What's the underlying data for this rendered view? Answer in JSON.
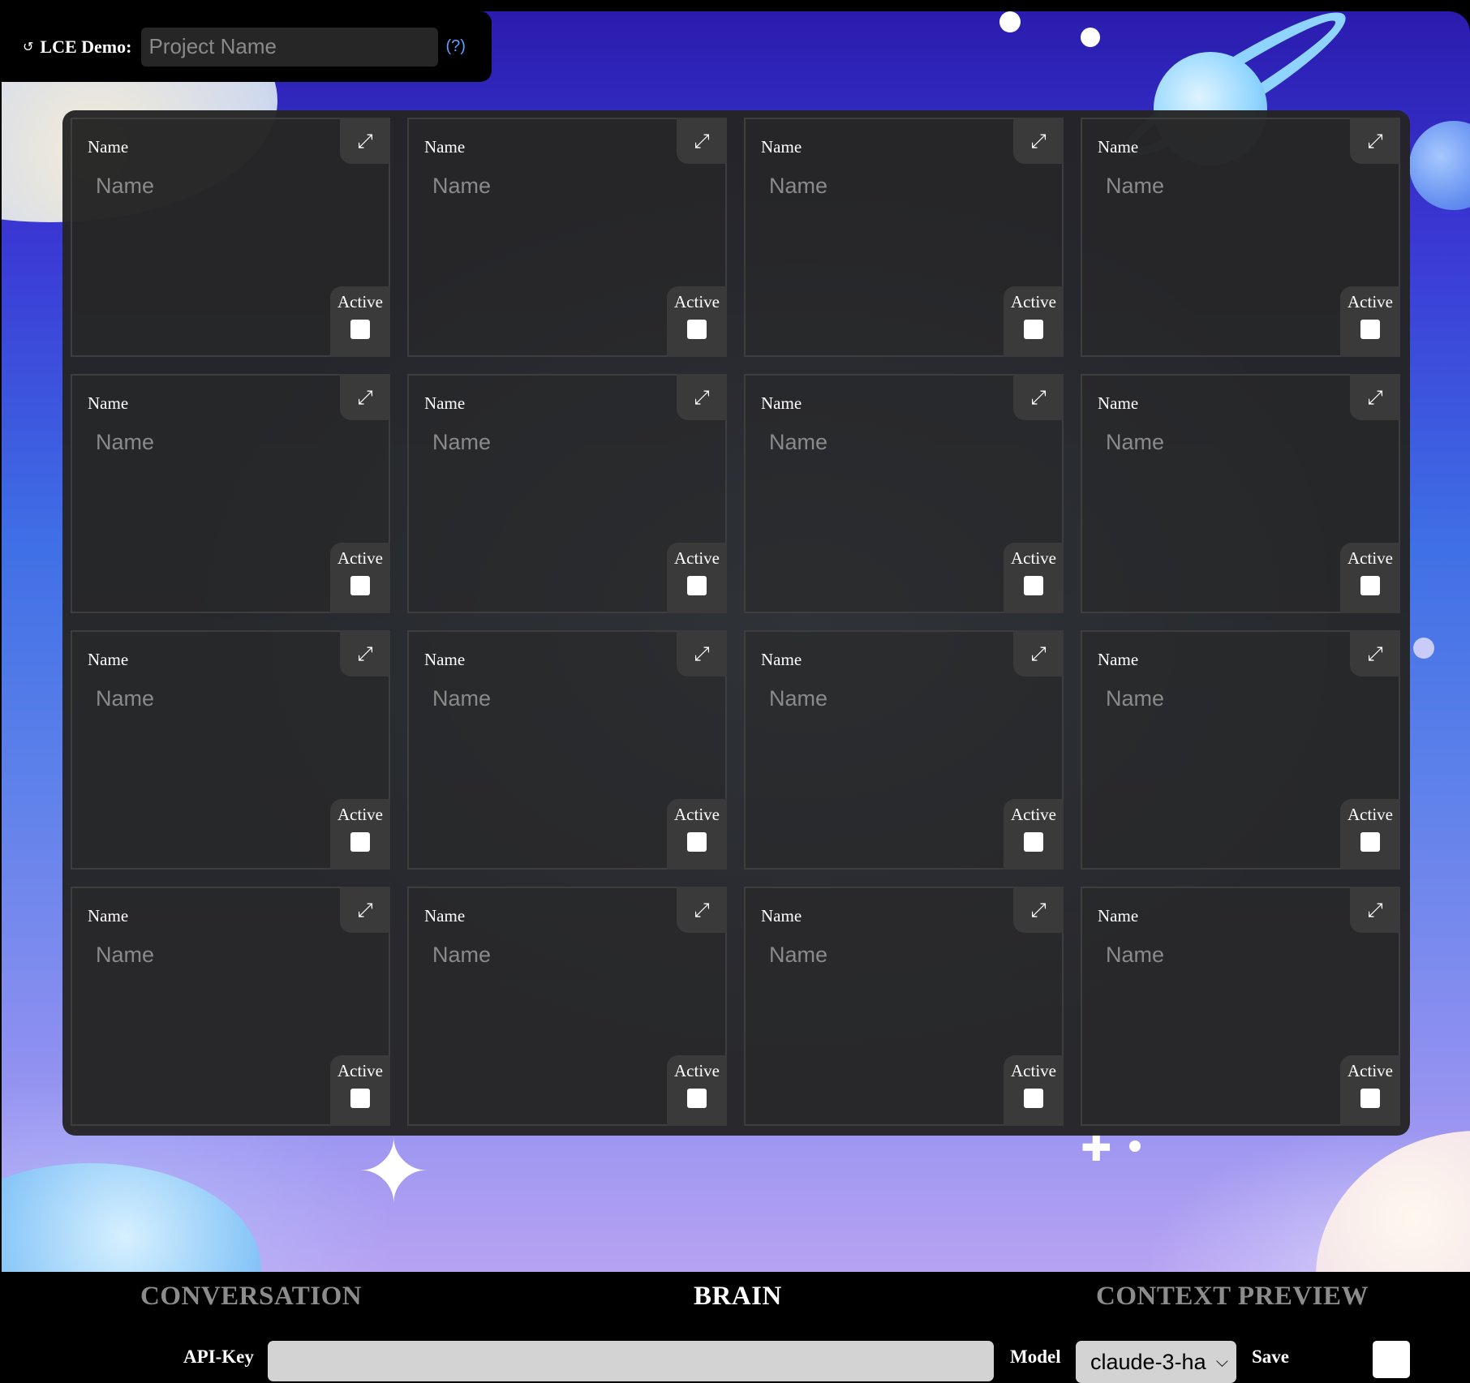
{
  "header": {
    "reload_icon": "↺",
    "title": "LCE Demo:",
    "project_placeholder": "Project Name",
    "help_text": "(?)"
  },
  "cards": [
    {
      "label": "Name",
      "placeholder": "Name",
      "active_label": "Active",
      "active": false
    },
    {
      "label": "Name",
      "placeholder": "Name",
      "active_label": "Active",
      "active": false
    },
    {
      "label": "Name",
      "placeholder": "Name",
      "active_label": "Active",
      "active": false
    },
    {
      "label": "Name",
      "placeholder": "Name",
      "active_label": "Active",
      "active": false
    },
    {
      "label": "Name",
      "placeholder": "Name",
      "active_label": "Active",
      "active": false
    },
    {
      "label": "Name",
      "placeholder": "Name",
      "active_label": "Active",
      "active": false
    },
    {
      "label": "Name",
      "placeholder": "Name",
      "active_label": "Active",
      "active": false
    },
    {
      "label": "Name",
      "placeholder": "Name",
      "active_label": "Active",
      "active": false
    },
    {
      "label": "Name",
      "placeholder": "Name",
      "active_label": "Active",
      "active": false
    },
    {
      "label": "Name",
      "placeholder": "Name",
      "active_label": "Active",
      "active": false
    },
    {
      "label": "Name",
      "placeholder": "Name",
      "active_label": "Active",
      "active": false
    },
    {
      "label": "Name",
      "placeholder": "Name",
      "active_label": "Active",
      "active": false
    },
    {
      "label": "Name",
      "placeholder": "Name",
      "active_label": "Active",
      "active": false
    },
    {
      "label": "Name",
      "placeholder": "Name",
      "active_label": "Active",
      "active": false
    },
    {
      "label": "Name",
      "placeholder": "Name",
      "active_label": "Active",
      "active": false
    },
    {
      "label": "Name",
      "placeholder": "Name",
      "active_label": "Active",
      "active": false
    }
  ],
  "expand_icon": "⤢",
  "tabs": {
    "conversation": "CONVERSATION",
    "brain": "BRAIN",
    "context_preview": "CONTEXT PREVIEW",
    "active": "BRAIN"
  },
  "footer": {
    "api_key_label": "API-Key",
    "api_key_value": "",
    "model_label": "Model",
    "model_value": "claude-3-ha",
    "model_chevron": "⌵",
    "save_label": "Save",
    "save_checked": false
  },
  "colors": {
    "panel": "#242424",
    "card_border": "#3e3e3e",
    "inactive_tab": "#8c8c8c",
    "help_link": "#5aa0ff"
  }
}
